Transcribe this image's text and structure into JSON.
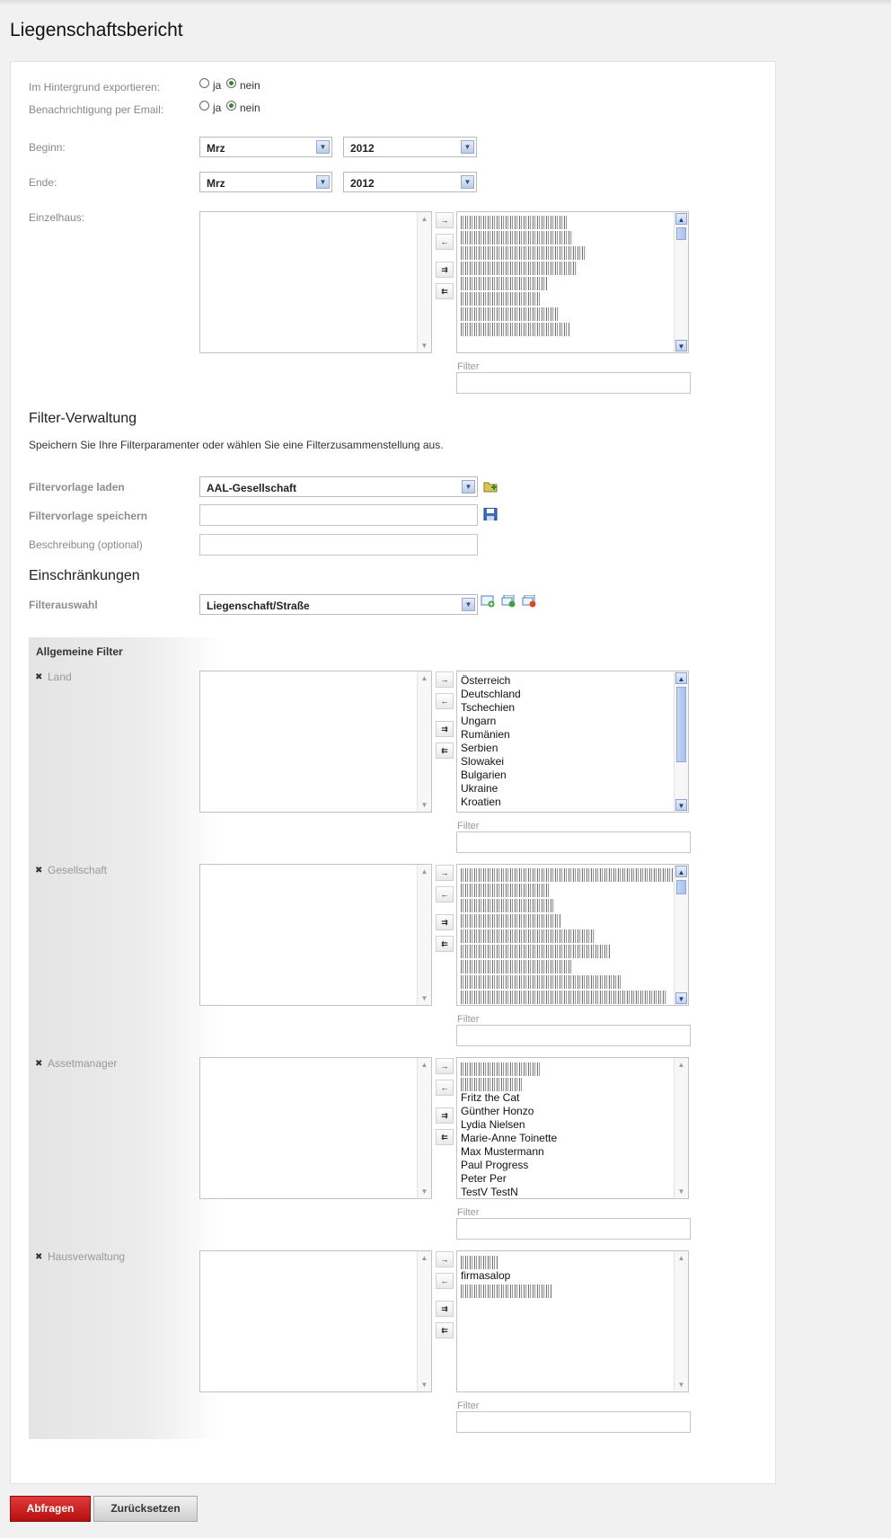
{
  "page": {
    "title": "Liegenschaftsbericht"
  },
  "options": {
    "background_export": {
      "label": "Im Hintergrund exportieren:",
      "yes": "ja",
      "no": "nein",
      "selected": "nein"
    },
    "email_notify": {
      "label": "Benachrichtigung per Email:",
      "yes": "ja",
      "no": "nein",
      "selected": "nein"
    }
  },
  "period": {
    "begin": {
      "label": "Beginn:",
      "month": "Mrz",
      "year": "2012"
    },
    "end": {
      "label": "Ende:",
      "month": "Mrz",
      "year": "2012"
    }
  },
  "filter_label": "Filter",
  "single_house": {
    "label": "Einzelhaus:",
    "filter_label": "Filter"
  },
  "filter_admin": {
    "heading": "Filter-Verwaltung",
    "description": "Speichern Sie Ihre Filterparamenter oder wählen Sie eine Filterzusammenstellung aus.",
    "load_label": "Filtervorlage laden",
    "load_value": "AAL-Gesellschaft",
    "save_label": "Filtervorlage speichern",
    "desc_label": "Beschreibung (optional)"
  },
  "restrictions": {
    "heading": "Einschränkungen",
    "selection_label": "Filterauswahl",
    "selection_value": "Liegenschaft/Straße"
  },
  "general_filter": {
    "title": "Allgemeine Filter",
    "land": {
      "label": "Land",
      "items": [
        "Österreich",
        "Deutschland",
        "Tschechien",
        "Ungarn",
        "Rumänien",
        "Serbien",
        "Slowakei",
        "Bulgarien",
        "Ukraine",
        "Kroatien"
      ]
    },
    "company": {
      "label": "Gesellschaft"
    },
    "asset": {
      "label": "Assetmanager",
      "items": [
        "Fritz the Cat",
        "Günther Honzo",
        "Lydia Nielsen",
        "Marie-Anne Toinette",
        "Max Mustermann",
        "Paul Progress",
        "Peter Per",
        "TestV TestN"
      ]
    },
    "housing": {
      "label": "Hausverwaltung",
      "items": [
        "firmasalop"
      ]
    }
  },
  "mover": {
    "add": "→",
    "remove": "←",
    "add_all": "⇉",
    "remove_all": "⇇",
    "up": "▲",
    "down": "▼",
    "dropdown": "▼"
  },
  "actions": {
    "query": "Abfragen",
    "reset": "Zurücksetzen"
  },
  "colors": {
    "primary_button": "#c91f1f",
    "radio_selected": "#2f8a2f"
  }
}
